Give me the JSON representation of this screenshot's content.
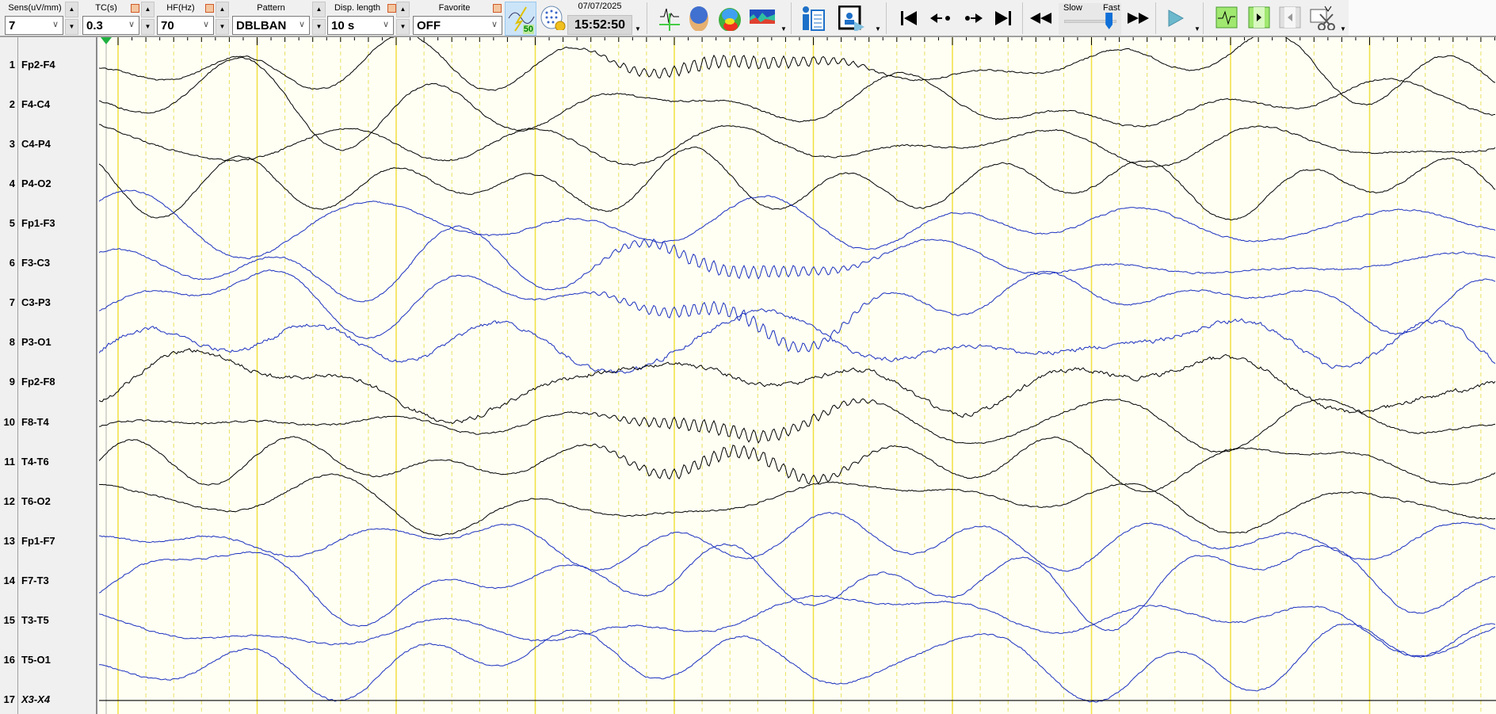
{
  "toolbar": {
    "sens": {
      "label": "Sens(uV/mm)",
      "value": "7"
    },
    "tc": {
      "label": "TC(s)",
      "value": "0.3"
    },
    "hf": {
      "label": "HF(Hz)",
      "value": "70"
    },
    "pattern": {
      "label": "Pattern",
      "value": "DBLBAN"
    },
    "disp_length": {
      "label": "Disp. length",
      "value": "10 s"
    },
    "favorite": {
      "label": "Favorite",
      "value": "OFF"
    },
    "filter_badge": "50",
    "date": "07/07/2025",
    "time": "15:52:50",
    "speed": {
      "slow_label": "Slow",
      "fast_label": "Fast",
      "value": 0.9
    }
  },
  "channels": [
    {
      "num": "1",
      "name": "Fp2-F4",
      "color": "#000000"
    },
    {
      "num": "2",
      "name": "F4-C4",
      "color": "#000000"
    },
    {
      "num": "3",
      "name": "C4-P4",
      "color": "#000000"
    },
    {
      "num": "4",
      "name": "P4-O2",
      "color": "#000000"
    },
    {
      "num": "5",
      "name": "Fp1-F3",
      "color": "#1a2fbf"
    },
    {
      "num": "6",
      "name": "F3-C3",
      "color": "#1a2fbf"
    },
    {
      "num": "7",
      "name": "C3-P3",
      "color": "#1a2fbf"
    },
    {
      "num": "8",
      "name": "P3-O1",
      "color": "#1a2fbf"
    },
    {
      "num": "9",
      "name": "Fp2-F8",
      "color": "#000000"
    },
    {
      "num": "10",
      "name": "F8-T4",
      "color": "#000000"
    },
    {
      "num": "11",
      "name": "T4-T6",
      "color": "#000000"
    },
    {
      "num": "12",
      "name": "T6-O2",
      "color": "#000000"
    },
    {
      "num": "13",
      "name": "Fp1-F7",
      "color": "#1a2fbf"
    },
    {
      "num": "14",
      "name": "F7-T3",
      "color": "#1a2fbf"
    },
    {
      "num": "15",
      "name": "T3-T5",
      "color": "#1a2fbf"
    },
    {
      "num": "16",
      "name": "T5-O1",
      "color": "#1a2fbf"
    },
    {
      "num": "17",
      "name": "X3-X4",
      "color": "#000000"
    }
  ]
}
